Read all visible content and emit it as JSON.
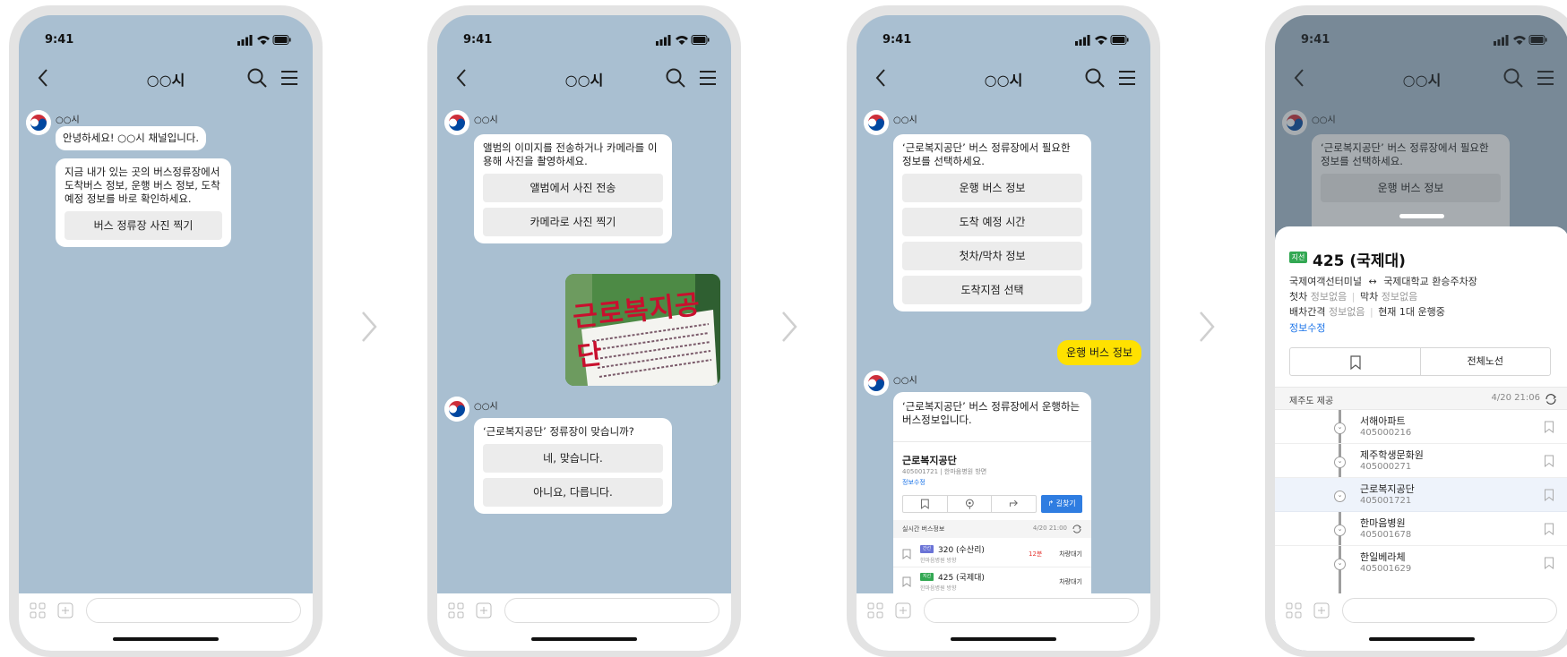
{
  "status": {
    "time": "9:41"
  },
  "header": {
    "title": "○○시"
  },
  "sender": {
    "name": "○○시"
  },
  "screen1": {
    "greeting": "안녕하세요! ○○시 채널입니다.",
    "intro": "지금 내가 있는 곳의 버스정류장에서 도착버스 정보, 운행 버스 정보, 도착예정 정보를 바로 확인하세요.",
    "button": "버스 정류장 사진 찍기"
  },
  "screen2": {
    "prompt": "앨범의 이미지를 전송하거나 카메라를 이용해 사진을 촬영하세요.",
    "btn_album": "앨범에서 사진 전송",
    "btn_camera": "카메라로 사진 찍기",
    "photo_sign": "근로복지공단",
    "confirm": "‘근로복지공단’ 정류장이 맞습니까?",
    "btn_yes": "네, 맞습니다.",
    "btn_no": "아니요, 다릅니다."
  },
  "screen3": {
    "prompt": "‘근로복지공단’ 버스 정류장에서 필요한 정보를 선택하세요.",
    "options": [
      "운행 버스 정보",
      "도착 예정 시간",
      "첫차/막차 정보",
      "도착지점 선택"
    ],
    "user_reply": "운행 버스 정보",
    "answer": "‘근로복지공단’ 버스 정류장에서 운행하는 버스정보입니다.",
    "stop_name": "근로복지공단",
    "stop_code": "405001721",
    "stop_direction": "한마음병원 방면",
    "info_edit": "정보수정",
    "route_btn": "길찾기",
    "realtime_label": "실시간 버스정보",
    "realtime_time": "4/20 21:00",
    "buses": [
      {
        "badge": "간선",
        "badge_color": "#6a73d6",
        "route": "320 (수산리)",
        "dir": "한마음병원 방향",
        "eta": "12분",
        "status": "차량대기"
      },
      {
        "badge": "지선",
        "badge_color": "#33a853",
        "route": "425 (국제대)",
        "dir": "한마음병원 방향",
        "eta": "",
        "status": "차량대기"
      }
    ]
  },
  "screen4": {
    "badge": "지선",
    "badge_color": "#33a853",
    "route_title": "425 (국제대)",
    "from": "국제여객선터미널",
    "to": "국제대학교 환승주차장",
    "first_label": "첫차",
    "first_value": "정보없음",
    "last_label": "막차",
    "last_value": "정보없음",
    "interval_label": "배차간격",
    "interval_value": "정보없음",
    "running": "현재 1대 운행중",
    "info_edit": "정보수정",
    "all_routes": "전체노선",
    "provider": "제주도 제공",
    "updated": "4/20 21:06",
    "stops": [
      {
        "name": "서해아파트",
        "code": "405000216",
        "current": false
      },
      {
        "name": "제주학생문화원",
        "code": "405000271",
        "current": false
      },
      {
        "name": "근로복지공단",
        "code": "405001721",
        "current": true
      },
      {
        "name": "한마음병원",
        "code": "405001678",
        "current": false
      },
      {
        "name": "한일베라체",
        "code": "405001629",
        "current": false
      }
    ]
  },
  "colors": {
    "chat_bg": "#a9bfd1",
    "accent_yellow": "#ffe100",
    "link_blue": "#1a73e8",
    "route_btn": "#2f7de1"
  }
}
